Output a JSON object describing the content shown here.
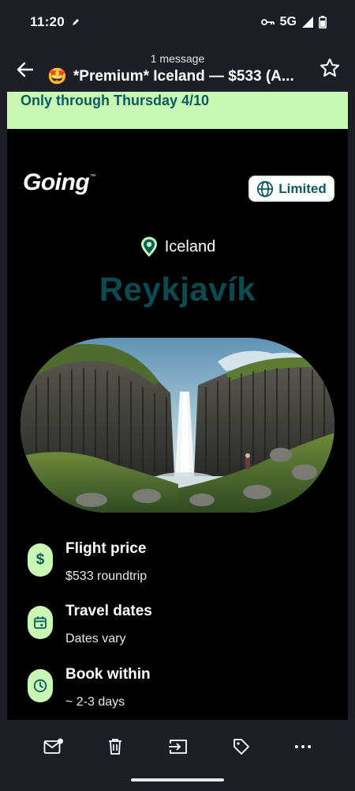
{
  "status": {
    "time": "11:20",
    "network": "5G"
  },
  "header": {
    "message_count": "1 message",
    "subject_emoji": "🤩",
    "subject": "*Premium* Iceland —  $533 (A..."
  },
  "email": {
    "banner": "Only through Thursday 4/10",
    "logo_text": "Going",
    "logo_tm": "™",
    "badge": "Limited",
    "country": "Iceland",
    "city": "Reykjavík",
    "details": [
      {
        "icon": "$",
        "title": "Flight price",
        "value": "$533 roundtrip"
      },
      {
        "icon": "calendar-icon",
        "title": "Travel dates",
        "value": "Dates vary"
      },
      {
        "icon": "clock-icon",
        "title": "Book within",
        "value": "~ 2-3 days"
      }
    ]
  },
  "colors": {
    "accent_green": "#c9f7b4",
    "brand_teal": "#0c5b5f",
    "city_teal": "#0c4a52",
    "chrome_bg": "#1e1f26"
  },
  "bottom_actions": [
    "mark-unread-icon",
    "trash-icon",
    "move-to-icon",
    "label-icon",
    "more-icon"
  ]
}
